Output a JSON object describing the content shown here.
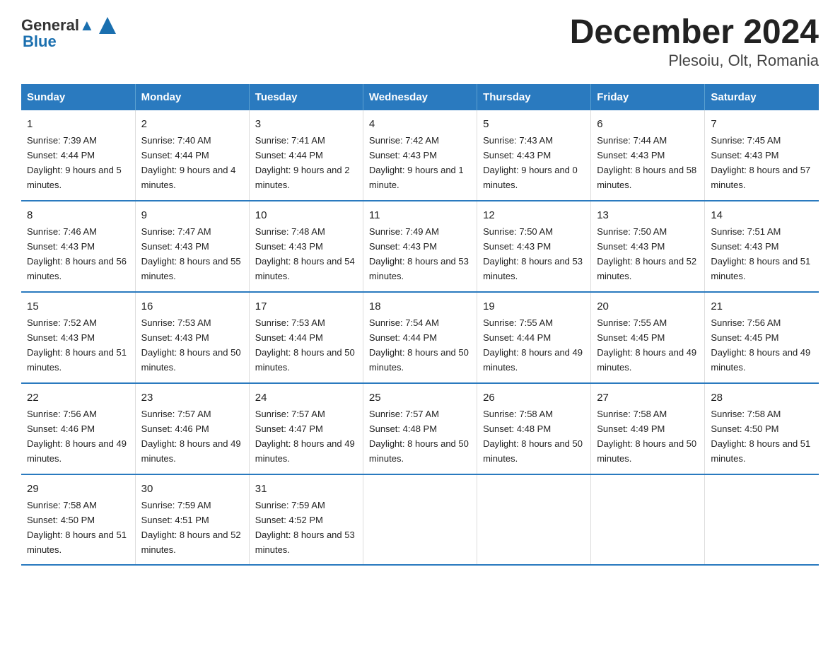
{
  "header": {
    "logo_line1": "General",
    "logo_line2": "Blue",
    "title": "December 2024",
    "subtitle": "Plesoiu, Olt, Romania"
  },
  "days_of_week": [
    "Sunday",
    "Monday",
    "Tuesday",
    "Wednesday",
    "Thursday",
    "Friday",
    "Saturday"
  ],
  "weeks": [
    [
      {
        "day": "1",
        "sunrise": "7:39 AM",
        "sunset": "4:44 PM",
        "daylight": "9 hours and 5 minutes."
      },
      {
        "day": "2",
        "sunrise": "7:40 AM",
        "sunset": "4:44 PM",
        "daylight": "9 hours and 4 minutes."
      },
      {
        "day": "3",
        "sunrise": "7:41 AM",
        "sunset": "4:44 PM",
        "daylight": "9 hours and 2 minutes."
      },
      {
        "day": "4",
        "sunrise": "7:42 AM",
        "sunset": "4:43 PM",
        "daylight": "9 hours and 1 minute."
      },
      {
        "day": "5",
        "sunrise": "7:43 AM",
        "sunset": "4:43 PM",
        "daylight": "9 hours and 0 minutes."
      },
      {
        "day": "6",
        "sunrise": "7:44 AM",
        "sunset": "4:43 PM",
        "daylight": "8 hours and 58 minutes."
      },
      {
        "day": "7",
        "sunrise": "7:45 AM",
        "sunset": "4:43 PM",
        "daylight": "8 hours and 57 minutes."
      }
    ],
    [
      {
        "day": "8",
        "sunrise": "7:46 AM",
        "sunset": "4:43 PM",
        "daylight": "8 hours and 56 minutes."
      },
      {
        "day": "9",
        "sunrise": "7:47 AM",
        "sunset": "4:43 PM",
        "daylight": "8 hours and 55 minutes."
      },
      {
        "day": "10",
        "sunrise": "7:48 AM",
        "sunset": "4:43 PM",
        "daylight": "8 hours and 54 minutes."
      },
      {
        "day": "11",
        "sunrise": "7:49 AM",
        "sunset": "4:43 PM",
        "daylight": "8 hours and 53 minutes."
      },
      {
        "day": "12",
        "sunrise": "7:50 AM",
        "sunset": "4:43 PM",
        "daylight": "8 hours and 53 minutes."
      },
      {
        "day": "13",
        "sunrise": "7:50 AM",
        "sunset": "4:43 PM",
        "daylight": "8 hours and 52 minutes."
      },
      {
        "day": "14",
        "sunrise": "7:51 AM",
        "sunset": "4:43 PM",
        "daylight": "8 hours and 51 minutes."
      }
    ],
    [
      {
        "day": "15",
        "sunrise": "7:52 AM",
        "sunset": "4:43 PM",
        "daylight": "8 hours and 51 minutes."
      },
      {
        "day": "16",
        "sunrise": "7:53 AM",
        "sunset": "4:43 PM",
        "daylight": "8 hours and 50 minutes."
      },
      {
        "day": "17",
        "sunrise": "7:53 AM",
        "sunset": "4:44 PM",
        "daylight": "8 hours and 50 minutes."
      },
      {
        "day": "18",
        "sunrise": "7:54 AM",
        "sunset": "4:44 PM",
        "daylight": "8 hours and 50 minutes."
      },
      {
        "day": "19",
        "sunrise": "7:55 AM",
        "sunset": "4:44 PM",
        "daylight": "8 hours and 49 minutes."
      },
      {
        "day": "20",
        "sunrise": "7:55 AM",
        "sunset": "4:45 PM",
        "daylight": "8 hours and 49 minutes."
      },
      {
        "day": "21",
        "sunrise": "7:56 AM",
        "sunset": "4:45 PM",
        "daylight": "8 hours and 49 minutes."
      }
    ],
    [
      {
        "day": "22",
        "sunrise": "7:56 AM",
        "sunset": "4:46 PM",
        "daylight": "8 hours and 49 minutes."
      },
      {
        "day": "23",
        "sunrise": "7:57 AM",
        "sunset": "4:46 PM",
        "daylight": "8 hours and 49 minutes."
      },
      {
        "day": "24",
        "sunrise": "7:57 AM",
        "sunset": "4:47 PM",
        "daylight": "8 hours and 49 minutes."
      },
      {
        "day": "25",
        "sunrise": "7:57 AM",
        "sunset": "4:48 PM",
        "daylight": "8 hours and 50 minutes."
      },
      {
        "day": "26",
        "sunrise": "7:58 AM",
        "sunset": "4:48 PM",
        "daylight": "8 hours and 50 minutes."
      },
      {
        "day": "27",
        "sunrise": "7:58 AM",
        "sunset": "4:49 PM",
        "daylight": "8 hours and 50 minutes."
      },
      {
        "day": "28",
        "sunrise": "7:58 AM",
        "sunset": "4:50 PM",
        "daylight": "8 hours and 51 minutes."
      }
    ],
    [
      {
        "day": "29",
        "sunrise": "7:58 AM",
        "sunset": "4:50 PM",
        "daylight": "8 hours and 51 minutes."
      },
      {
        "day": "30",
        "sunrise": "7:59 AM",
        "sunset": "4:51 PM",
        "daylight": "8 hours and 52 minutes."
      },
      {
        "day": "31",
        "sunrise": "7:59 AM",
        "sunset": "4:52 PM",
        "daylight": "8 hours and 53 minutes."
      },
      null,
      null,
      null,
      null
    ]
  ]
}
